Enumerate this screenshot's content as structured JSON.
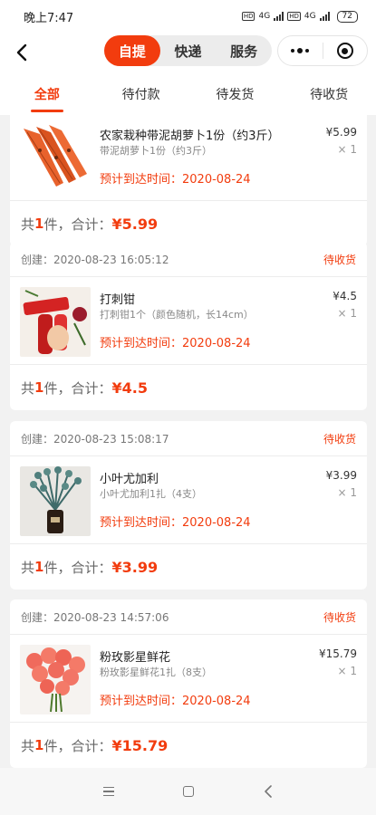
{
  "status_bar": {
    "time": "晚上7:47",
    "net1": "4G",
    "net2": "4G",
    "battery": "72"
  },
  "header": {
    "segments": [
      {
        "label": "自提",
        "active": true
      },
      {
        "label": "快递",
        "active": false
      },
      {
        "label": "服务",
        "active": false
      }
    ]
  },
  "tabs": [
    {
      "label": "全部",
      "active": true
    },
    {
      "label": "待付款",
      "active": false
    },
    {
      "label": "待发货",
      "active": false
    },
    {
      "label": "待收货",
      "active": false
    }
  ],
  "orders": [
    {
      "created": "",
      "status": "",
      "name": "农家栽种带泥胡萝卜1份（约3斤）",
      "desc": "带泥胡萝卜1份（约3斤）",
      "price": "¥5.99",
      "qty": "× 1",
      "eta": "预计到达时间：2020-08-24",
      "count_prefix": "共 ",
      "count": "1",
      "count_suffix": "件，合计：",
      "total": "¥5.99"
    },
    {
      "created": "创建：2020-08-23 16:05:12",
      "status": "待收货",
      "name": "打刺钳",
      "desc": "打刺钳1个（颜色随机，长14cm）",
      "price": "¥4.5",
      "qty": "× 1",
      "eta": "预计到达时间：2020-08-24",
      "count_prefix": "共 ",
      "count": "1",
      "count_suffix": "件，合计：",
      "total": "¥4.5"
    },
    {
      "created": "创建：2020-08-23 15:08:17",
      "status": "待收货",
      "name": "小叶尤加利",
      "desc": "小叶尤加利1扎（4支）",
      "price": "¥3.99",
      "qty": "× 1",
      "eta": "预计到达时间：2020-08-24",
      "count_prefix": "共 ",
      "count": "1",
      "count_suffix": "件，合计：",
      "total": "¥3.99"
    },
    {
      "created": "创建：2020-08-23 14:57:06",
      "status": "待收货",
      "name": "粉玫影星鲜花",
      "desc": "粉玫影星鲜花1扎（8支）",
      "price": "¥15.79",
      "qty": "× 1",
      "eta": "预计到达时间：2020-08-24",
      "count_prefix": "共 ",
      "count": "1",
      "count_suffix": "件，合计：",
      "total": "¥15.79"
    }
  ],
  "colors": {
    "accent": "#f23c0e",
    "background": "#f2f2f2"
  },
  "icons": {
    "back": "back-arrow-icon",
    "more": "more-dots-icon",
    "scan": "target-icon",
    "sys_menu": "menu-icon",
    "sys_home": "home-square-icon",
    "sys_back": "back-chevron-icon"
  }
}
